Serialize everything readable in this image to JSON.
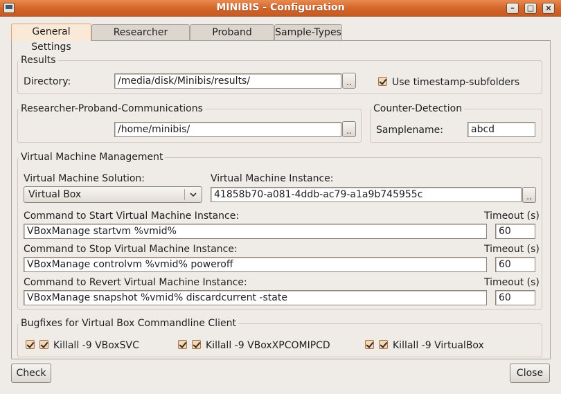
{
  "window": {
    "title": "MINIBIS - Configuration",
    "minimize_glyph": "–",
    "maximize_glyph": "□",
    "close_glyph": "×"
  },
  "tabs": [
    {
      "label": "General Settings",
      "active": true
    },
    {
      "label": "Researcher Scripting",
      "active": false
    },
    {
      "label": "Proband Scripting",
      "active": false
    },
    {
      "label": "Sample-Types",
      "active": false
    }
  ],
  "results": {
    "group_label": "Results",
    "directory_label": "Directory:",
    "directory_value": "/media/disk/Minibis/results/",
    "browse_label": "..",
    "timestamp_label": "Use timestamp-subfolders",
    "timestamp_checked": true
  },
  "communications": {
    "group_label": "Researcher-Proband-Communications",
    "path_value": "/home/minibis/",
    "browse_label": ".."
  },
  "counter_detection": {
    "group_label": "Counter-Detection",
    "samplename_label": "Samplename:",
    "samplename_value": "abcd"
  },
  "vm": {
    "group_label": "Virtual Machine Management",
    "solution_label": "Virtual Machine Solution:",
    "solution_value": "Virtual Box",
    "instance_label": "Virtual Machine Instance:",
    "instance_value": "41858b70-a081-4ddb-ac79-a1a9b745955c",
    "browse_label": "..",
    "timeout_label": "Timeout (s)",
    "start_label": "Command to Start Virtual Machine Instance:",
    "start_value": "VBoxManage startvm %vmid%",
    "start_timeout": "60",
    "stop_label": "Command to Stop Virtual Machine Instance:",
    "stop_value": "VBoxManage controlvm %vmid% poweroff",
    "stop_timeout": "60",
    "revert_label": "Command to Revert Virtual Machine Instance:",
    "revert_value": "VBoxManage snapshot %vmid% discardcurrent -state",
    "revert_timeout": "60"
  },
  "bugfixes": {
    "group_label": "Bugfixes for Virtual Box Commandline Client",
    "items": [
      {
        "label": "Killall -9 VBoxSVC",
        "checked": true
      },
      {
        "label": "Killall -9 VBoxXPCOMIPCD",
        "checked": true
      },
      {
        "label": "Killall -9 VirtualBox",
        "checked": true
      }
    ]
  },
  "footer": {
    "check_label": "Check",
    "close_label": "Close"
  },
  "colors": {
    "titlebar": "#d4652a",
    "active_tab": "#fbe9d8",
    "checkbox_fill": "#f3d8b8"
  }
}
